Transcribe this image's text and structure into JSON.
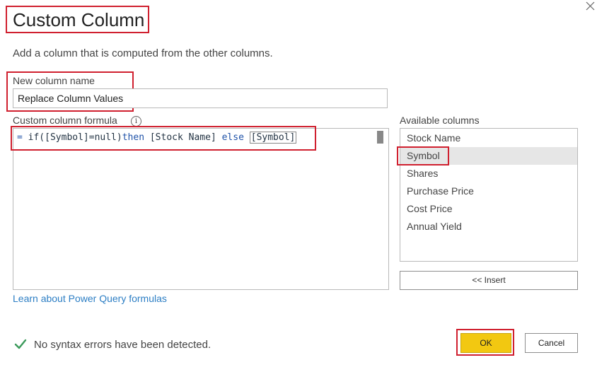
{
  "dialog": {
    "title": "Custom Column",
    "subtitle": "Add a column that is computed from the other columns."
  },
  "new_column": {
    "label": "New column name",
    "value": "Replace Column Values"
  },
  "formula": {
    "label": "Custom column formula",
    "tokens": {
      "eq": "=",
      "func": "if([Symbol]=null)",
      "then": "then",
      "stock": "[Stock Name]",
      "else": "else",
      "symbol": "[Symbol]"
    }
  },
  "learn_link": "Learn about Power Query formulas",
  "available": {
    "label": "Available columns",
    "items": [
      {
        "label": "Stock Name",
        "selected": false
      },
      {
        "label": "Symbol",
        "selected": true
      },
      {
        "label": "Shares",
        "selected": false
      },
      {
        "label": "Purchase Price",
        "selected": false
      },
      {
        "label": "Cost Price",
        "selected": false
      },
      {
        "label": "Annual Yield",
        "selected": false
      }
    ],
    "insert_label": "<< Insert"
  },
  "status": {
    "text": "No syntax errors have been detected.",
    "icon": "checkmark-icon",
    "color": "#3a9a5a"
  },
  "buttons": {
    "ok": "OK",
    "cancel": "Cancel"
  },
  "colors": {
    "highlight": "#d0202f",
    "ok_button": "#f2c811",
    "link": "#2c7ec4"
  }
}
